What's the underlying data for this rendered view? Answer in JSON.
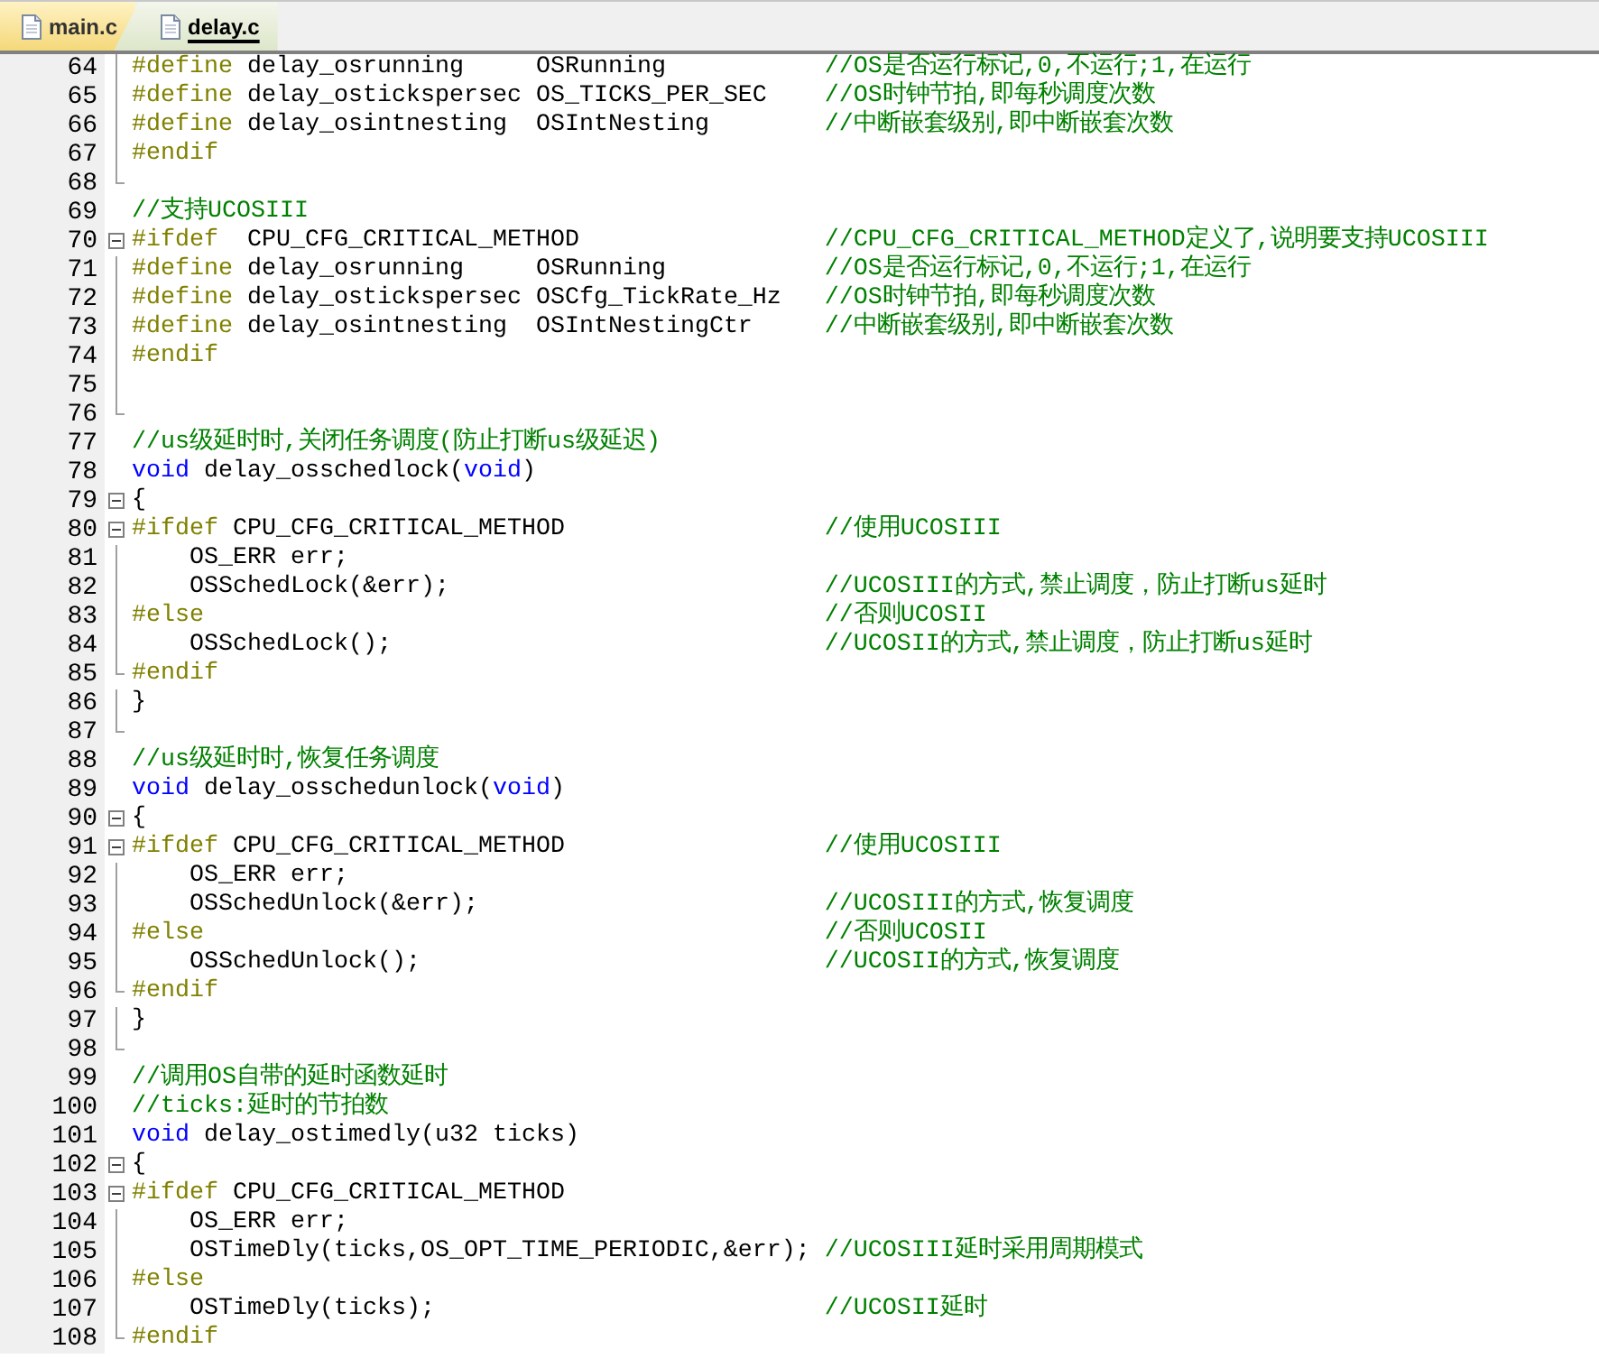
{
  "tabs": [
    {
      "label": "main.c",
      "selected": false
    },
    {
      "label": "delay.c",
      "selected": true
    }
  ],
  "lines": [
    {
      "num": "64",
      "kind": "body",
      "code": [
        {
          "kind": "directive",
          "text": "#define"
        },
        {
          "kind": "plain",
          "text": " delay_osrunning     OSRunning"
        }
      ],
      "comment": "//OS是否运行标记,0,不运行;1,在运行"
    },
    {
      "num": "65",
      "kind": "body",
      "code": [
        {
          "kind": "directive",
          "text": "#define"
        },
        {
          "kind": "plain",
          "text": " delay_ostickspersec OS_TICKS_PER_SEC"
        }
      ],
      "comment": "//OS时钟节拍,即每秒调度次数"
    },
    {
      "num": "66",
      "kind": "body",
      "code": [
        {
          "kind": "directive",
          "text": "#define"
        },
        {
          "kind": "plain",
          "text": " delay_osintnesting  OSIntNesting"
        }
      ],
      "comment": "//中断嵌套级别,即中断嵌套次数"
    },
    {
      "num": "67",
      "kind": "body",
      "code": [
        {
          "kind": "directive",
          "text": "#endif"
        }
      ]
    },
    {
      "num": "68",
      "kind": "end"
    },
    {
      "num": "69",
      "kind": "free",
      "code": [
        {
          "kind": "comment",
          "text": "//支持UCOSIII"
        }
      ]
    },
    {
      "num": "70",
      "kind": "start",
      "code": [
        {
          "kind": "directive",
          "text": "#ifdef"
        },
        {
          "kind": "plain",
          "text": "  CPU_CFG_CRITICAL_METHOD"
        }
      ],
      "comment": "//CPU_CFG_CRITICAL_METHOD定义了,说明要支持UCOSIII"
    },
    {
      "num": "71",
      "kind": "body",
      "code": [
        {
          "kind": "directive",
          "text": "#define"
        },
        {
          "kind": "plain",
          "text": " delay_osrunning     OSRunning"
        }
      ],
      "comment": "//OS是否运行标记,0,不运行;1,在运行"
    },
    {
      "num": "72",
      "kind": "body",
      "code": [
        {
          "kind": "directive",
          "text": "#define"
        },
        {
          "kind": "plain",
          "text": " delay_ostickspersec OSCfg_TickRate_Hz"
        }
      ],
      "comment": "//OS时钟节拍,即每秒调度次数"
    },
    {
      "num": "73",
      "kind": "body",
      "code": [
        {
          "kind": "directive",
          "text": "#define"
        },
        {
          "kind": "plain",
          "text": " delay_osintnesting  OSIntNestingCtr"
        }
      ],
      "comment": "//中断嵌套级别,即中断嵌套次数"
    },
    {
      "num": "74",
      "kind": "body",
      "code": [
        {
          "kind": "directive",
          "text": "#endif"
        }
      ]
    },
    {
      "num": "75",
      "kind": "body"
    },
    {
      "num": "76",
      "kind": "end"
    },
    {
      "num": "77",
      "kind": "free",
      "code": [
        {
          "kind": "comment",
          "text": "//us级延时时,关闭任务调度(防止打断us级延迟)"
        }
      ]
    },
    {
      "num": "78",
      "kind": "free",
      "code": [
        {
          "kind": "keyword",
          "text": "void"
        },
        {
          "kind": "plain",
          "text": " delay_osschedlock("
        },
        {
          "kind": "keyword",
          "text": "void"
        },
        {
          "kind": "plain",
          "text": ")"
        }
      ]
    },
    {
      "num": "79",
      "kind": "start",
      "code": [
        {
          "kind": "plain",
          "text": "{"
        }
      ]
    },
    {
      "num": "80",
      "kind": "start",
      "code": [
        {
          "kind": "directive",
          "text": "#ifdef"
        },
        {
          "kind": "plain",
          "text": " CPU_CFG_CRITICAL_METHOD"
        }
      ],
      "comment": "//使用UCOSIII"
    },
    {
      "num": "81",
      "kind": "body",
      "code": [
        {
          "kind": "plain",
          "text": "    OS_ERR err;"
        }
      ]
    },
    {
      "num": "82",
      "kind": "body",
      "code": [
        {
          "kind": "plain",
          "text": "    OSSchedLock(&err);"
        }
      ],
      "comment": "//UCOSIII的方式,禁止调度，防止打断us延时"
    },
    {
      "num": "83",
      "kind": "body",
      "code": [
        {
          "kind": "directive",
          "text": "#else"
        }
      ],
      "comment": "//否则UCOSII"
    },
    {
      "num": "84",
      "kind": "body",
      "code": [
        {
          "kind": "plain",
          "text": "    OSSchedLock();"
        }
      ],
      "comment": "//UCOSII的方式,禁止调度，防止打断us延时"
    },
    {
      "num": "85",
      "kind": "end",
      "code": [
        {
          "kind": "directive",
          "text": "#endif"
        }
      ]
    },
    {
      "num": "86",
      "kind": "body",
      "code": [
        {
          "kind": "plain",
          "text": "}"
        }
      ]
    },
    {
      "num": "87",
      "kind": "end"
    },
    {
      "num": "88",
      "kind": "free",
      "code": [
        {
          "kind": "comment",
          "text": "//us级延时时,恢复任务调度"
        }
      ]
    },
    {
      "num": "89",
      "kind": "free",
      "code": [
        {
          "kind": "keyword",
          "text": "void"
        },
        {
          "kind": "plain",
          "text": " delay_osschedunlock("
        },
        {
          "kind": "keyword",
          "text": "void"
        },
        {
          "kind": "plain",
          "text": ")"
        }
      ]
    },
    {
      "num": "90",
      "kind": "start",
      "code": [
        {
          "kind": "plain",
          "text": "{"
        }
      ]
    },
    {
      "num": "91",
      "kind": "start",
      "code": [
        {
          "kind": "directive",
          "text": "#ifdef"
        },
        {
          "kind": "plain",
          "text": " CPU_CFG_CRITICAL_METHOD"
        }
      ],
      "comment": "//使用UCOSIII"
    },
    {
      "num": "92",
      "kind": "body",
      "code": [
        {
          "kind": "plain",
          "text": "    OS_ERR err;"
        }
      ]
    },
    {
      "num": "93",
      "kind": "body",
      "code": [
        {
          "kind": "plain",
          "text": "    OSSchedUnlock(&err);"
        }
      ],
      "comment": "//UCOSIII的方式,恢复调度"
    },
    {
      "num": "94",
      "kind": "body",
      "code": [
        {
          "kind": "directive",
          "text": "#else"
        }
      ],
      "comment": "//否则UCOSII"
    },
    {
      "num": "95",
      "kind": "body",
      "code": [
        {
          "kind": "plain",
          "text": "    OSSchedUnlock();"
        }
      ],
      "comment": "//UCOSII的方式,恢复调度"
    },
    {
      "num": "96",
      "kind": "end",
      "code": [
        {
          "kind": "directive",
          "text": "#endif"
        }
      ]
    },
    {
      "num": "97",
      "kind": "body",
      "code": [
        {
          "kind": "plain",
          "text": "}"
        }
      ]
    },
    {
      "num": "98",
      "kind": "end"
    },
    {
      "num": "99",
      "kind": "free",
      "code": [
        {
          "kind": "comment",
          "text": "//调用OS自带的延时函数延时"
        }
      ]
    },
    {
      "num": "100",
      "kind": "free",
      "code": [
        {
          "kind": "comment",
          "text": "//ticks:延时的节拍数"
        }
      ]
    },
    {
      "num": "101",
      "kind": "free",
      "code": [
        {
          "kind": "keyword",
          "text": "void"
        },
        {
          "kind": "plain",
          "text": " delay_ostimedly(u32 ticks)"
        }
      ]
    },
    {
      "num": "102",
      "kind": "start",
      "code": [
        {
          "kind": "plain",
          "text": "{"
        }
      ]
    },
    {
      "num": "103",
      "kind": "start",
      "code": [
        {
          "kind": "directive",
          "text": "#ifdef"
        },
        {
          "kind": "plain",
          "text": " CPU_CFG_CRITICAL_METHOD"
        }
      ]
    },
    {
      "num": "104",
      "kind": "body",
      "code": [
        {
          "kind": "plain",
          "text": "    OS_ERR err;"
        }
      ]
    },
    {
      "num": "105",
      "kind": "body",
      "code": [
        {
          "kind": "plain",
          "text": "    OSTimeDly(ticks,OS_OPT_TIME_PERIODIC,&err);"
        }
      ],
      "comment": "//UCOSIII延时采用周期模式"
    },
    {
      "num": "106",
      "kind": "body",
      "code": [
        {
          "kind": "directive",
          "text": "#else"
        }
      ]
    },
    {
      "num": "107",
      "kind": "body",
      "code": [
        {
          "kind": "plain",
          "text": "    OSTimeDly(ticks);"
        }
      ],
      "comment": "//UCOSII延时"
    },
    {
      "num": "108",
      "kind": "end",
      "code": [
        {
          "kind": "directive",
          "text": "#endif"
        }
      ]
    }
  ]
}
